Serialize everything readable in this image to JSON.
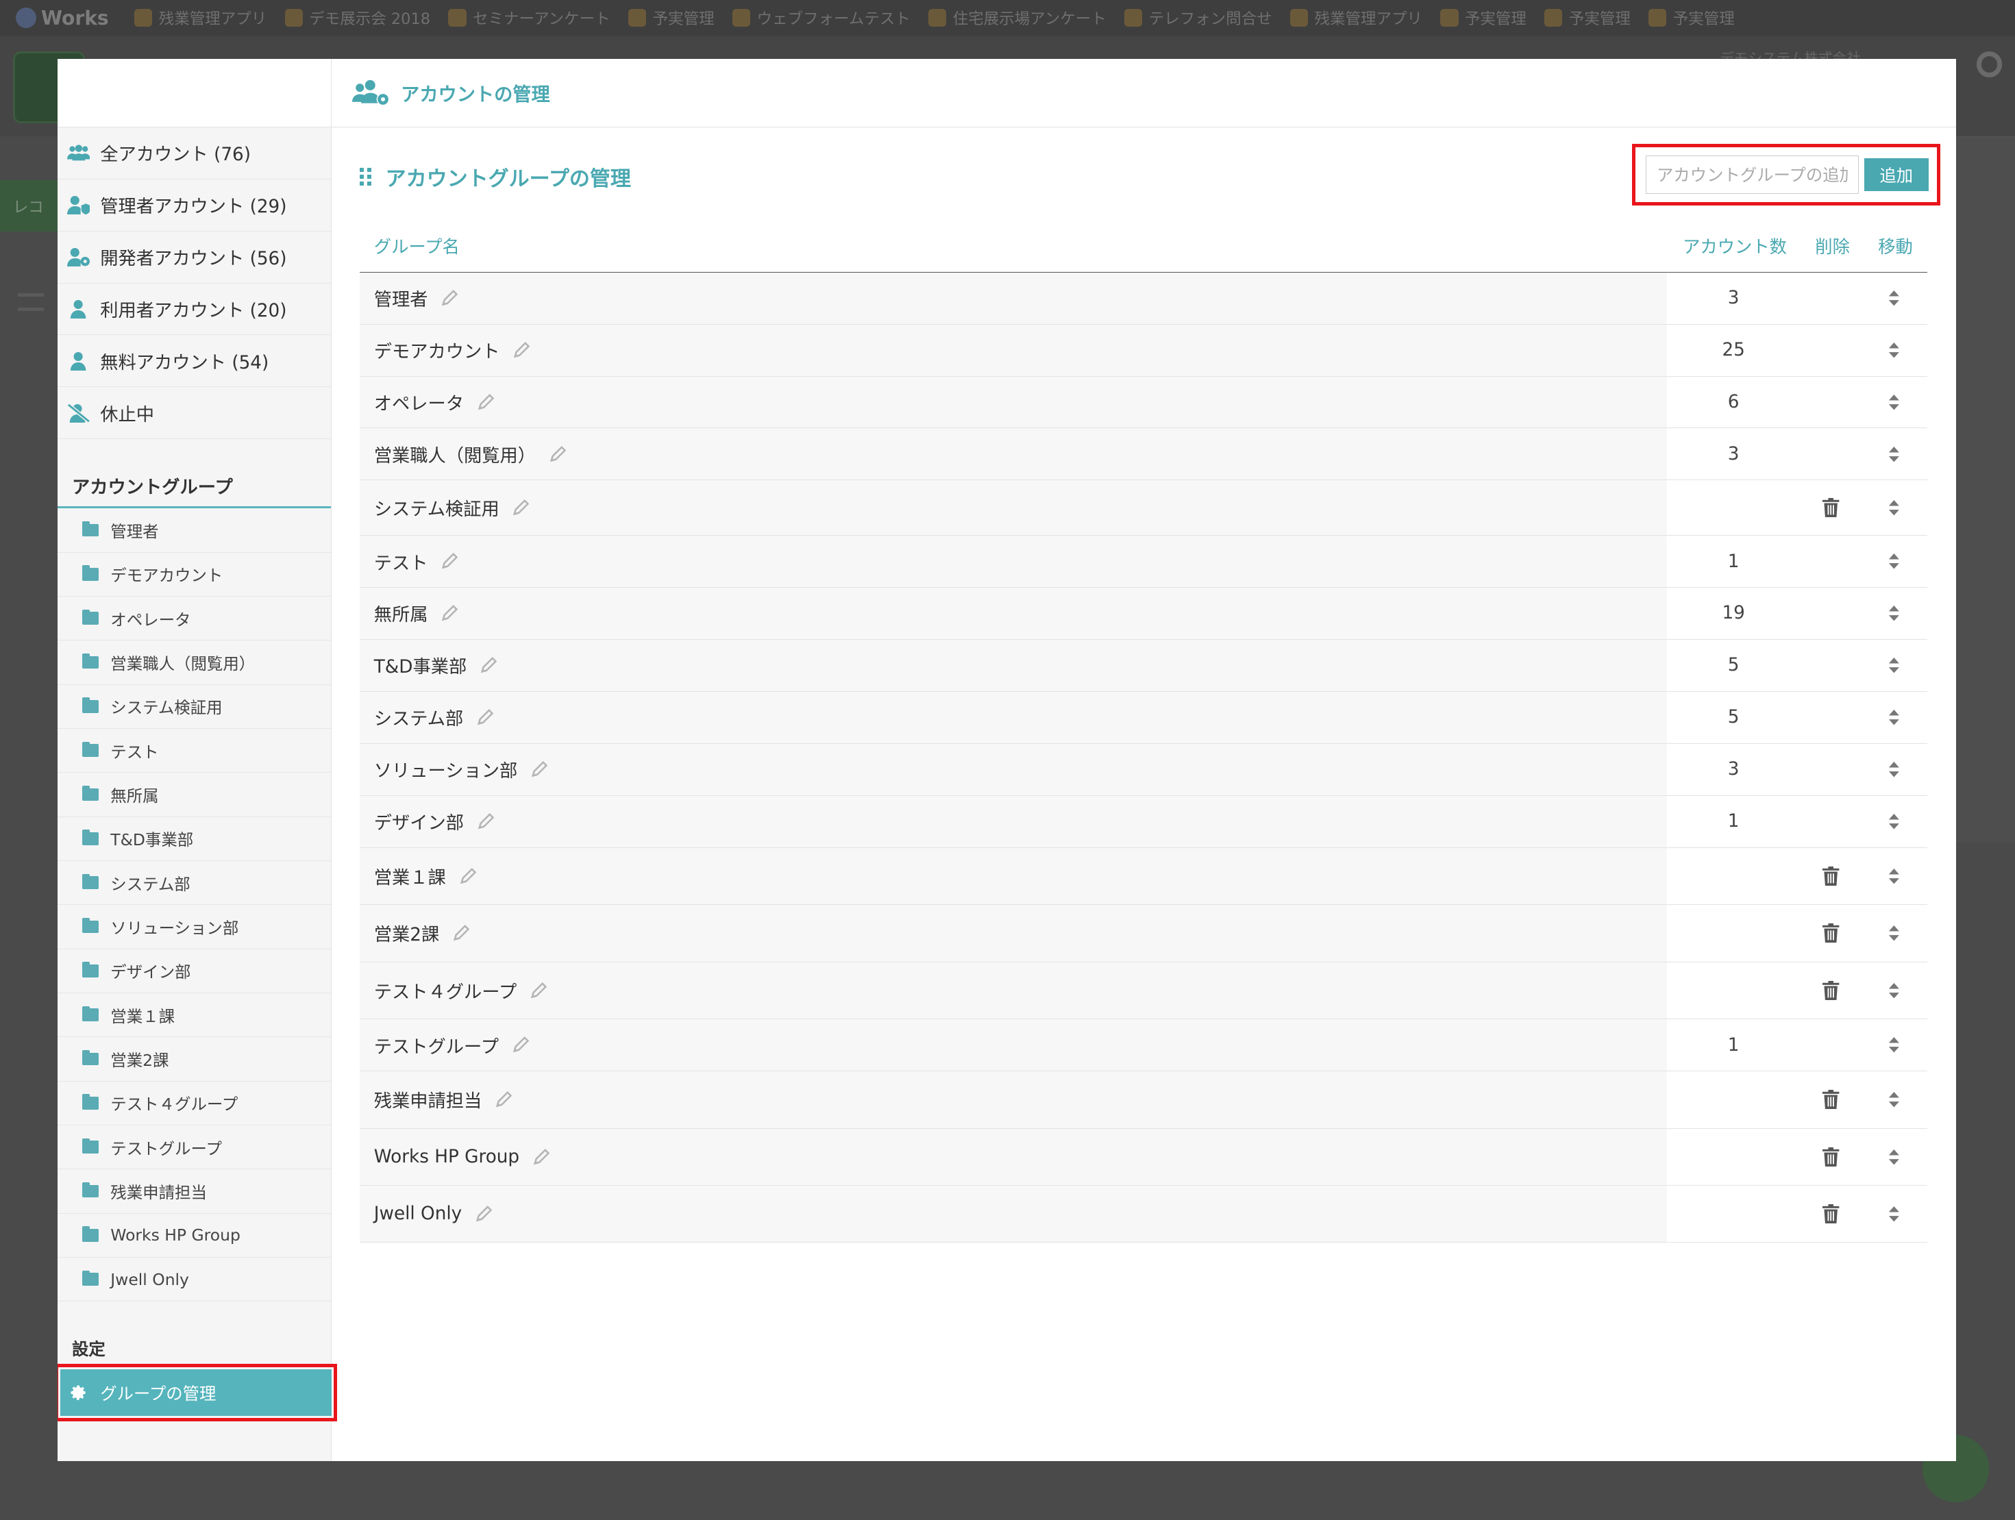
{
  "background": {
    "app_name": "Works",
    "bookmarks": [
      "残業管理アプリ",
      "デモ展示会 2018",
      "セミナーアンケート",
      "予実管理",
      "ウェブフォームテスト",
      "住宅展示場アンケート",
      "テレフォン問合せ",
      "残業管理アプリ",
      "予実管理",
      "予実管理",
      "予実管理"
    ],
    "company": "デモシステム株式会社",
    "green_label": "レコ"
  },
  "header": {
    "title": "アカウントの管理"
  },
  "sidebar": {
    "accounts": [
      {
        "label": "全アカウント (76)",
        "icon": "users-icon"
      },
      {
        "label": "管理者アカウント (29)",
        "icon": "user-shield-icon"
      },
      {
        "label": "開発者アカウント (56)",
        "icon": "user-gear-icon"
      },
      {
        "label": "利用者アカウント (20)",
        "icon": "user-icon"
      },
      {
        "label": "無料アカウント (54)",
        "icon": "user-icon"
      },
      {
        "label": "休止中",
        "icon": "user-slash-icon"
      }
    ],
    "groups_title": "アカウントグループ",
    "groups": [
      "管理者",
      "デモアカウント",
      "オペレータ",
      "営業職人（閲覧用）",
      "システム検証用",
      "テスト",
      "無所属",
      "T&D事業部",
      "システム部",
      "ソリューション部",
      "デザイン部",
      "営業１課",
      "営業2課",
      "テスト４グループ",
      "テストグループ",
      "残業申請担当",
      "Works HP Group",
      "Jwell Only"
    ],
    "settings_title": "設定",
    "settings_item": "グループの管理"
  },
  "main": {
    "section_title": "アカウントグループの管理",
    "add_placeholder": "アカウントグループの追加",
    "add_button": "追加",
    "columns": {
      "name": "グループ名",
      "count": "アカウント数",
      "delete": "削除",
      "move": "移動"
    },
    "rows": [
      {
        "name": "管理者",
        "count": "3",
        "deletable": false
      },
      {
        "name": "デモアカウント",
        "count": "25",
        "deletable": false
      },
      {
        "name": "オペレータ",
        "count": "6",
        "deletable": false
      },
      {
        "name": "営業職人（閲覧用）",
        "count": "3",
        "deletable": false
      },
      {
        "name": "システム検証用",
        "count": "",
        "deletable": true
      },
      {
        "name": "テスト",
        "count": "1",
        "deletable": false
      },
      {
        "name": "無所属",
        "count": "19",
        "deletable": false
      },
      {
        "name": "T&D事業部",
        "count": "5",
        "deletable": false
      },
      {
        "name": "システム部",
        "count": "5",
        "deletable": false
      },
      {
        "name": "ソリューション部",
        "count": "3",
        "deletable": false
      },
      {
        "name": "デザイン部",
        "count": "1",
        "deletable": false
      },
      {
        "name": "営業１課",
        "count": "",
        "deletable": true
      },
      {
        "name": "営業2課",
        "count": "",
        "deletable": true
      },
      {
        "name": "テスト４グループ",
        "count": "",
        "deletable": true
      },
      {
        "name": "テストグループ",
        "count": "1",
        "deletable": false
      },
      {
        "name": "残業申請担当",
        "count": "",
        "deletable": true
      },
      {
        "name": "Works HP Group",
        "count": "",
        "deletable": true
      },
      {
        "name": "Jwell Only",
        "count": "",
        "deletable": true
      }
    ]
  },
  "colors": {
    "accent": "#4aa8b1",
    "highlight": "#e8161b",
    "active_bg": "#55b4bc"
  }
}
